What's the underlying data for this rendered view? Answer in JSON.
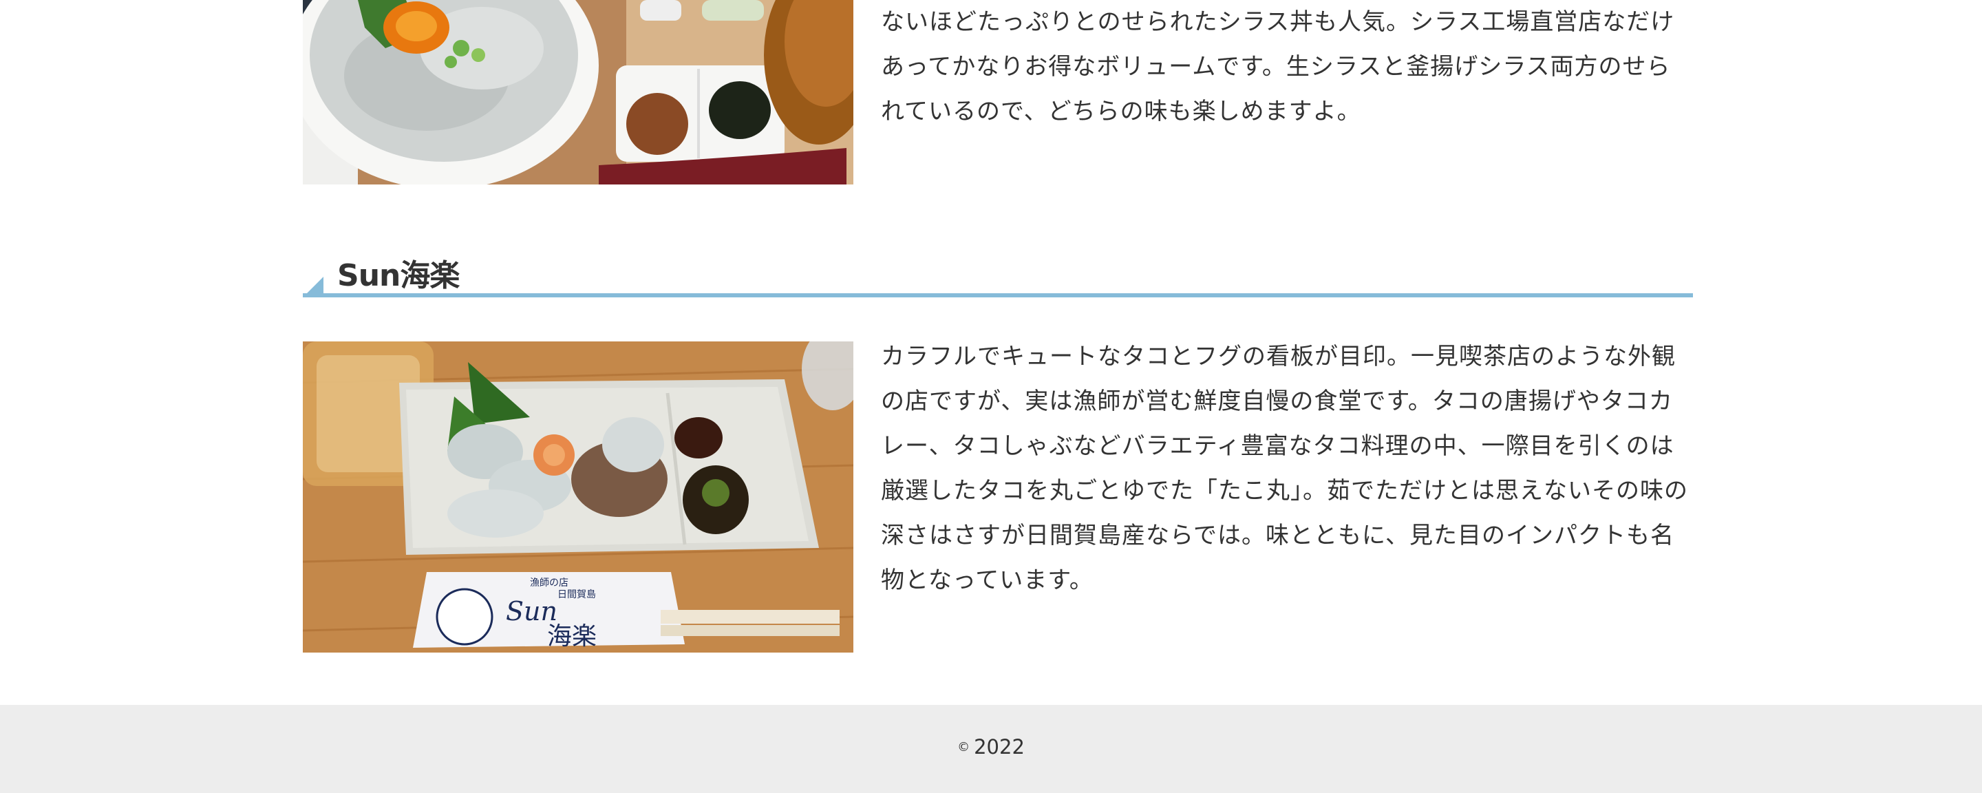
{
  "entries": [
    {
      "photo_icon": "shirasu-don-photo",
      "description": "ないほどたっぷりとのせられたシラス丼も人気。シラス工場直営店なだけあってかなりお得なボリュームです。生シラスと釜揚げシラス両方のせられているので、どちらの味も楽しめますよ。"
    },
    {
      "title": "Sun海楽",
      "photo_icon": "octopus-sashimi-photo",
      "chopstick_wrapper": {
        "line1": "漁師の店",
        "line2": "日間賀島",
        "brand": "Sun",
        "name": "海楽"
      },
      "description": "カラフルでキュートなタコとフグの看板が目印。一見喫茶店のような外観の店ですが、実は漁師が営む鮮度自慢の食堂です。タコの唐揚げやタコカレー、タコしゃぶなどバラエティ豊富なタコ料理の中、一際目を引くのは厳選したタコを丸ごとゆでた「たこ丸」。茹でただけとは思えないその味の深さはさすが日間賀島産ならでは。味とともに、見た目のインパクトも名物となっています。"
    }
  ],
  "footer": {
    "copyright_symbol": "©",
    "year": "2022"
  },
  "colors": {
    "heading_rule": "#86bbd9",
    "footer_bg": "#ededed",
    "text": "#333333"
  }
}
